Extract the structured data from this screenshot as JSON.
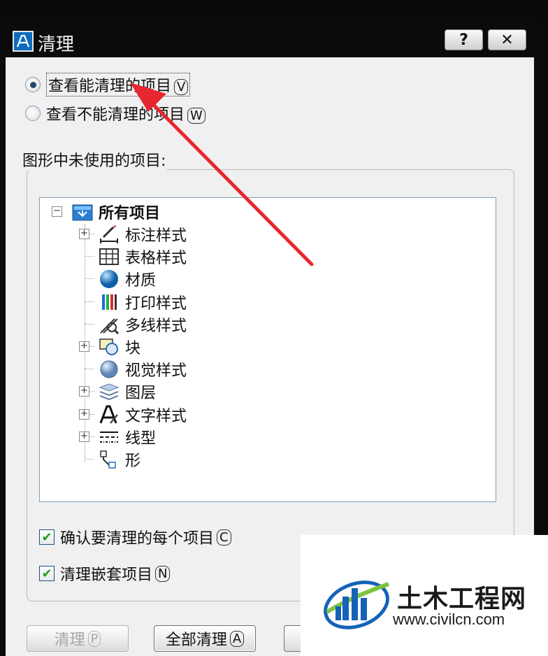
{
  "window": {
    "title": "清理",
    "help_label": "?",
    "close_label": "✕"
  },
  "options": {
    "view_purgeable": "查看能清理的项目",
    "view_purgeable_key": "V",
    "view_nonpurgeable": "查看不能清理的项目",
    "view_nonpurgeable_key": "W"
  },
  "tree": {
    "group_label": "图形中未使用的项目:",
    "root": "所有项目",
    "items": [
      {
        "label": "标注样式",
        "icon": "dimension-style-icon",
        "expandable": true
      },
      {
        "label": "表格样式",
        "icon": "table-style-icon",
        "expandable": false
      },
      {
        "label": "材质",
        "icon": "material-icon",
        "expandable": false
      },
      {
        "label": "打印样式",
        "icon": "plot-style-icon",
        "expandable": false
      },
      {
        "label": "多线样式",
        "icon": "multiline-style-icon",
        "expandable": false
      },
      {
        "label": "块",
        "icon": "block-icon",
        "expandable": true
      },
      {
        "label": "视觉样式",
        "icon": "visual-style-icon",
        "expandable": false
      },
      {
        "label": "图层",
        "icon": "layer-icon",
        "expandable": true
      },
      {
        "label": "文字样式",
        "icon": "text-style-icon",
        "expandable": true
      },
      {
        "label": "线型",
        "icon": "linetype-icon",
        "expandable": true
      },
      {
        "label": "形",
        "icon": "shape-icon",
        "expandable": false
      }
    ]
  },
  "checkboxes": {
    "confirm_each": "确认要清理的每个项目",
    "confirm_each_key": "C",
    "purge_nested": "清理嵌套项目",
    "purge_nested_key": "N"
  },
  "buttons": {
    "purge": "清理",
    "purge_key": "P",
    "purge_all": "全部清理",
    "purge_all_key": "A"
  },
  "watermark": {
    "name": "土木工程网",
    "url": "www.civilcn.com"
  },
  "colors": {
    "arrow": "#e8262f",
    "accent": "#0f6cbd"
  }
}
